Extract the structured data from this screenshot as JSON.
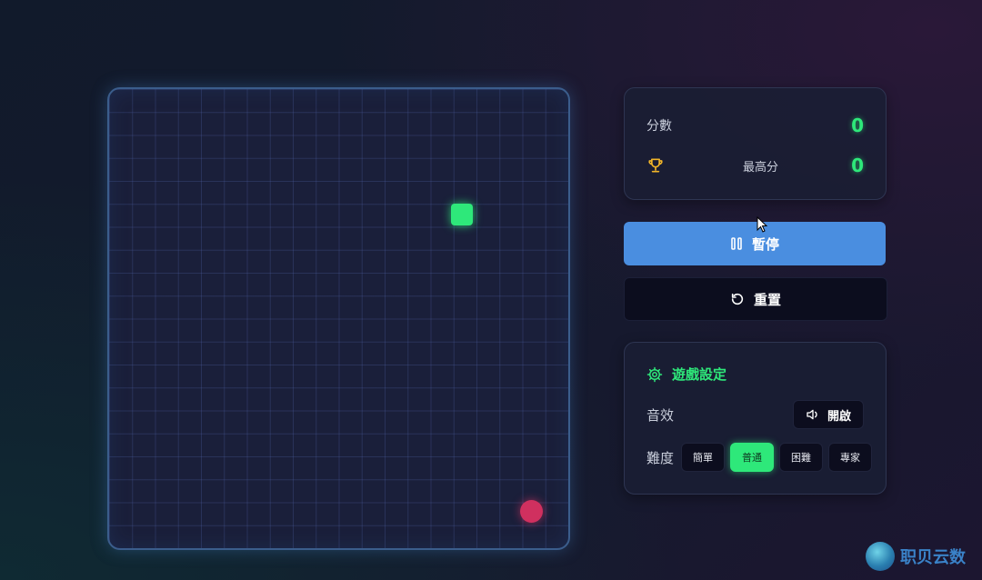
{
  "board": {
    "grid_cells": 20
  },
  "score_panel": {
    "score_label": "分數",
    "score_value": "0",
    "best_label": "最高分",
    "best_value": "0"
  },
  "buttons": {
    "pause_label": "暫停",
    "reset_label": "重置"
  },
  "settings": {
    "title": "遊戲設定",
    "sound_label": "音效",
    "sound_state": "開啟",
    "difficulty_label": "難度",
    "difficulties": [
      "簡單",
      "普通",
      "困難",
      "專家"
    ],
    "selected_difficulty": "普通"
  },
  "colors": {
    "accent": "#2ee87a",
    "pause_button": "#4a8ee0",
    "food": "#d0305f"
  },
  "icons": {
    "best": "trophy-icon",
    "pause": "pause-icon",
    "reset": "rotate-icon",
    "settings": "gear-icon",
    "sound": "speaker-icon"
  },
  "watermark": {
    "text": "职贝云数"
  }
}
